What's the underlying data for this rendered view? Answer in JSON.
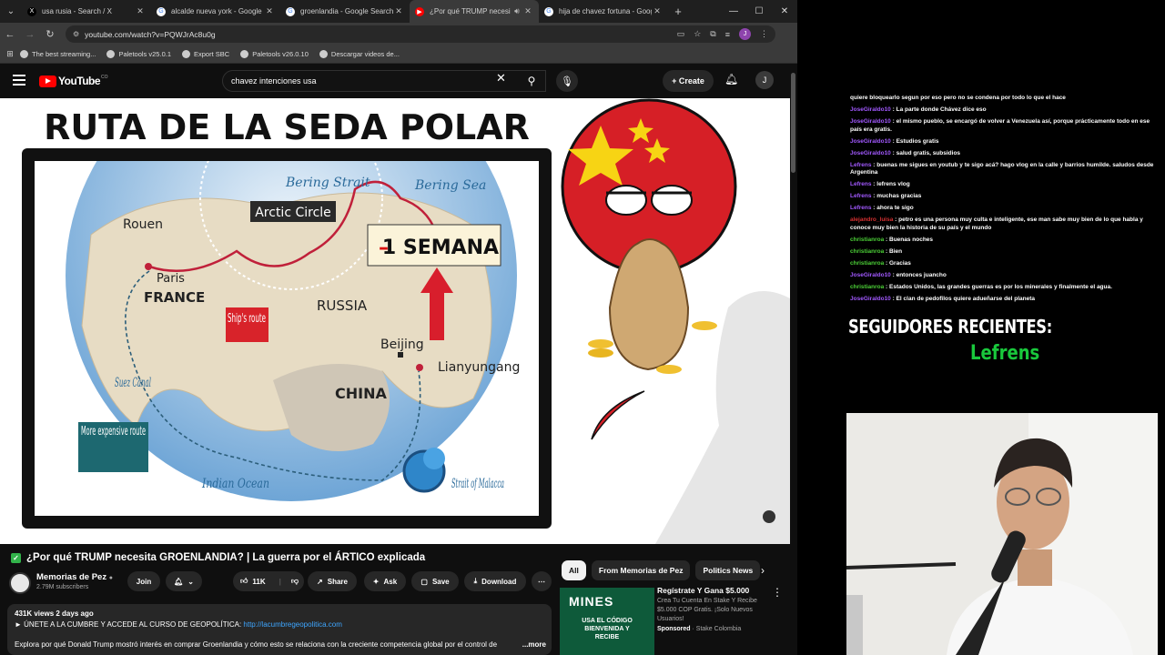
{
  "tabs": [
    {
      "title": "usa rusia - Search / X",
      "fav_color": "#000000",
      "fav_glyph": "X",
      "active": false
    },
    {
      "title": "alcalde nueva york - Google Se",
      "fav_color": "#ffffff",
      "fav_glyph": "G",
      "active": false
    },
    {
      "title": "groenlandia - Google Search",
      "fav_color": "#ffffff",
      "fav_glyph": "G",
      "active": false
    },
    {
      "title": "¿Por qué TRUMP necesi",
      "fav_color": "#ff0000",
      "fav_glyph": "▶",
      "active": true
    },
    {
      "title": "hija de chavez fortuna - Googl",
      "fav_color": "#ffffff",
      "fav_glyph": "G",
      "active": false
    }
  ],
  "url": "youtube.com/watch?v=PQWJrAc8u0g",
  "bookmarks": [
    "The best streaming...",
    "Paletools v25.0.1",
    "Export SBC",
    "Paletools v26.0.10",
    "Descargar videos de..."
  ],
  "account_initial": "J",
  "header": {
    "logo": "YouTube",
    "logo_sup": "CO",
    "search_value": "chavez intenciones usa",
    "create_label": "Create"
  },
  "video": {
    "frame_title": "RUTA DE LA SEDA POLAR",
    "labels": {
      "bering_strait": "Bering Strait",
      "bering_sea": "Bering Sea",
      "arctic_circle": "Arctic Circle",
      "semana": "1 SEMANA",
      "semana_dash": "–",
      "rouen": "Rouen",
      "paris": "Paris",
      "france": "FRANCE",
      "ships_route": "Ship's route",
      "russia": "RUSSIA",
      "beijing": "Beijing",
      "lianyungang": "Lianyungang",
      "suez": "Suez Canal",
      "china": "CHINA",
      "more_expensive": "More expensive route",
      "indian_ocean": "Indian Ocean",
      "malacca": "Strait of Malacca"
    },
    "title": "¿Por qué TRUMP necesita GROENLANDIA? | La guerra por el ÁRTICO explicada",
    "channel": "Memorias de Pez",
    "subscribers": "2.79M subscribers",
    "join_label": "Join",
    "likes": "11K",
    "share_label": "Share",
    "ask_label": "Ask",
    "save_label": "Save",
    "download_label": "Download",
    "views_line": "431K views  2 days ago",
    "promo_text": "► ÚNETE A LA CUMBRE Y ACCEDE AL CURSO DE GEOPOLÍTICA: ",
    "promo_link": "http://lacumbregeopolitica.com",
    "description": "Explora por qué Donald Trump mostró interés en comprar Groenlandia y cómo esto se relaciona con la creciente competencia global por el control de",
    "more_label": "...more"
  },
  "chips": [
    "All",
    "From Memorias de Pez",
    "Politics News"
  ],
  "ad": {
    "thumb_title": "MINES",
    "thumb_sub": "USA EL CÓDIGO BIENVENIDA Y RECIBE",
    "title": "Regístrate Y Gana $5.000",
    "body": "Crea Tu Cuenta En Stake Y Recibe $5.000 COP Gratis. ¡Solo Nuevos Usuarios!",
    "sponsored": "Sponsored",
    "advertiser": "Stake Colombia"
  },
  "chat": [
    {
      "user": "",
      "cls": "",
      "text": "quiere bloquearlo segun por eso pero no se condena por todo lo que el hace"
    },
    {
      "user": "JoseGiraldo10",
      "cls": "u-purple",
      "text": "La parte donde Chávez dice eso"
    },
    {
      "user": "JoseGiraldo10",
      "cls": "u-purple",
      "text": "el mismo pueblo, se encargó de volver a Venezuela así, porque prácticamente todo en ese país era gratis."
    },
    {
      "user": "JoseGiraldo10",
      "cls": "u-purple",
      "text": "Estudios gratis"
    },
    {
      "user": "JoseGiraldo10",
      "cls": "u-purple",
      "text": "salud gratis, subsidios"
    },
    {
      "user": "Lefrens",
      "cls": "u-purple",
      "text": "buenas me sigues en youtub y te sigo acá? hago vlog en la calle y barrios humilde. saludos desde Argentina"
    },
    {
      "user": "Lefrens",
      "cls": "u-purple",
      "text": "lefrens vlog"
    },
    {
      "user": "Lefrens",
      "cls": "u-purple",
      "text": "muchas gracias"
    },
    {
      "user": "Lefrens",
      "cls": "u-purple",
      "text": "ahora te sigo"
    },
    {
      "user": "alejandro_luisa",
      "cls": "u-red",
      "text": "petro es una persona muy culta e inteligente, ese man sabe muy bien de lo que habla y conoce muy bien la historia de su país y el mundo"
    },
    {
      "user": "christianroa",
      "cls": "u-green",
      "text": "Buenas noches"
    },
    {
      "user": "christianroa",
      "cls": "u-green",
      "text": "Bien"
    },
    {
      "user": "christianroa",
      "cls": "u-green",
      "text": "Gracias"
    },
    {
      "user": "JoseGiraldo10",
      "cls": "u-purple",
      "text": "entonces juancho"
    },
    {
      "user": "christianroa",
      "cls": "u-green",
      "text": "Estados Unidos, las grandes guerras es por los minerales y finalmente el agua."
    },
    {
      "user": "JoseGiraldo10",
      "cls": "u-purple",
      "text": "El clan de pedofilos quiere adueñarse del planeta"
    }
  ],
  "followers": {
    "heading": "SEGUIDORES RECIENTES:",
    "name": "Lefrens"
  },
  "colors": {
    "yt_red": "#ff0000",
    "link_blue": "#3ea6ff",
    "follower_green": "#19c83c",
    "chat_purple": "#a259ff",
    "chat_green": "#4cd137"
  }
}
